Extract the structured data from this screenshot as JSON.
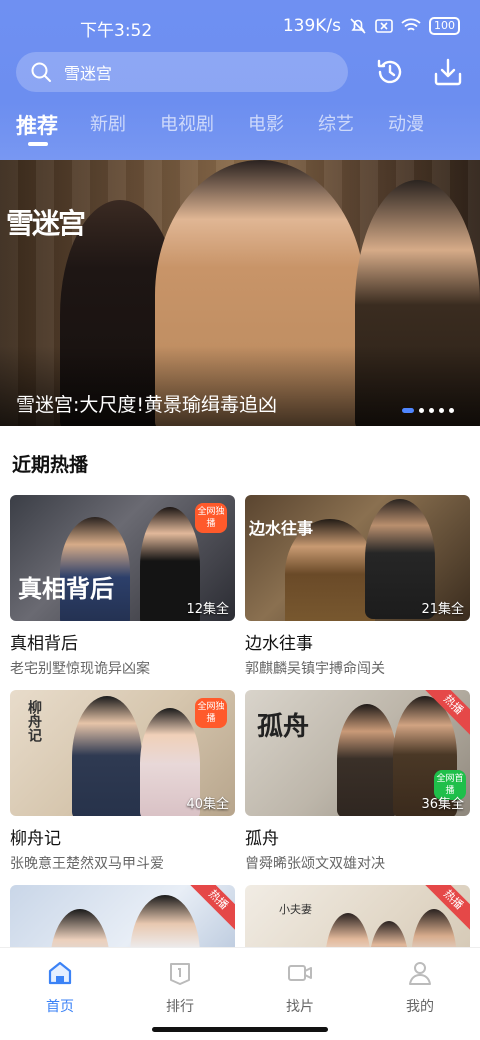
{
  "status": {
    "time": "下午3:52",
    "net_speed": "139K/s",
    "battery": "100"
  },
  "search": {
    "query": "雪迷宫"
  },
  "tabs": [
    "推荐",
    "新剧",
    "电视剧",
    "电影",
    "综艺",
    "动漫"
  ],
  "banner": {
    "title": "雪迷宫:大尺度!黄景瑜缉毒追凶",
    "logo_text": "雪迷宫",
    "slide_count": 5,
    "active_slide": 1
  },
  "section": {
    "title": "近期热播"
  },
  "cards": [
    {
      "title": "真相背后",
      "subtitle": "老宅别墅惊现诡异凶案",
      "episodes": "12集全",
      "badge": "全网独播",
      "poster_text": "真相背后"
    },
    {
      "title": "边水往事",
      "subtitle": "郭麒麟吴镇宇搏命闯关",
      "episodes": "21集全",
      "badge": "",
      "poster_text": "边水往事"
    },
    {
      "title": "柳舟记",
      "subtitle": "张晚意王楚然双马甲斗爱",
      "episodes": "40集全",
      "badge": "全网独播",
      "poster_text": "柳舟记"
    },
    {
      "title": "孤舟",
      "subtitle": "曾舜晞张颂文双雄对决",
      "episodes": "36集全",
      "badge": "全网首播",
      "hot": "热播",
      "poster_text": "孤舟"
    },
    {
      "hot": "热播"
    },
    {
      "hot": "热播",
      "poster_text": "小夫妻"
    }
  ],
  "nav": [
    {
      "label": "首页",
      "icon": "home-icon",
      "active": true
    },
    {
      "label": "排行",
      "icon": "ranking-icon",
      "active": false
    },
    {
      "label": "找片",
      "icon": "video-camera-icon",
      "active": false
    },
    {
      "label": "我的",
      "icon": "user-icon",
      "active": false
    }
  ],
  "colors": {
    "accent": "#3b82f6",
    "header_bg": "#6f90f2",
    "hot_badge": "#e54848",
    "exclusive_badge": "#ff5a2b"
  }
}
